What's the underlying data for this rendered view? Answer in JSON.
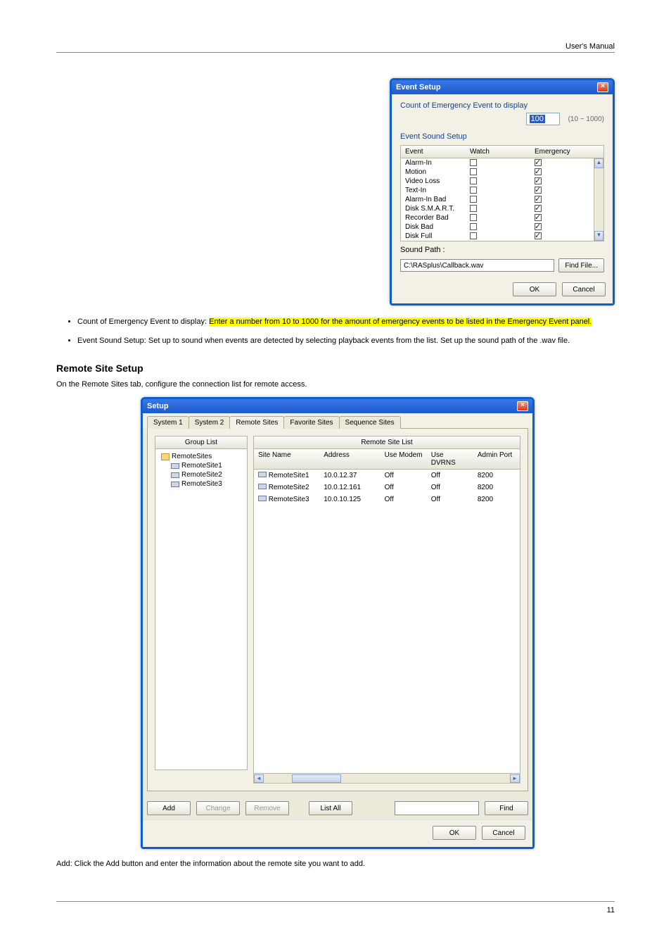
{
  "doc": {
    "header": "User's Manual",
    "page_number": "11",
    "bullets": [
      {
        "plain": "Count of Emergency Event to display: ",
        "hilite": "Enter a number from 10 to 1000 for the amount of emergency events to be listed in the Emergency Event panel."
      },
      {
        "plain": "Event Sound Setup: Set up to sound when events are detected by selecting playback events from the list. Set up the sound path of the .wav file."
      }
    ],
    "heading": "Remote Site Setup",
    "paragraph1": "On the Remote Sites tab, configure the connection list for remote access.",
    "paragraph2": "Add: Click the Add button and enter the information about the remote site you want to add."
  },
  "eventDialog": {
    "title": "Event Setup",
    "countLabel": "Count of Emergency Event to display",
    "countValue": "100",
    "countRange": "(10 ~ 1000)",
    "soundSetupLabel": "Event Sound Setup",
    "cols": {
      "event": "Event",
      "watch": "Watch",
      "emergency": "Emergency"
    },
    "rows": [
      {
        "name": "Alarm-In",
        "watch": false,
        "emergency": true
      },
      {
        "name": "Motion",
        "watch": false,
        "emergency": true
      },
      {
        "name": "Video Loss",
        "watch": false,
        "emergency": true
      },
      {
        "name": "Text-In",
        "watch": false,
        "emergency": true
      },
      {
        "name": "Alarm-In Bad",
        "watch": false,
        "emergency": true
      },
      {
        "name": "Disk S.M.A.R.T.",
        "watch": false,
        "emergency": true
      },
      {
        "name": "Recorder Bad",
        "watch": false,
        "emergency": true
      },
      {
        "name": "Disk Bad",
        "watch": false,
        "emergency": true
      },
      {
        "name": "Disk Full",
        "watch": false,
        "emergency": true
      }
    ],
    "soundPathLabel": "Sound Path :",
    "soundPathValue": "C:\\RASplus\\Callback.wav",
    "findFile": "Find File...",
    "ok": "OK",
    "cancel": "Cancel"
  },
  "setupDialog": {
    "title": "Setup",
    "tabs": [
      "System 1",
      "System 2",
      "Remote Sites",
      "Favorite Sites",
      "Sequence Sites"
    ],
    "activeTab": 2,
    "groupListLabel": "Group List",
    "tree": {
      "root": "RemoteSites",
      "children": [
        "RemoteSite1",
        "RemoteSite2",
        "RemoteSite3"
      ]
    },
    "siteListLabel": "Remote Site List",
    "cols": {
      "name": "Site Name",
      "addr": "Address",
      "modem": "Use Modem",
      "dvrns": "Use DVRNS",
      "port": "Admin Port"
    },
    "rows": [
      {
        "name": "RemoteSite1",
        "addr": "10.0.12.37",
        "modem": "Off",
        "dvrns": "Off",
        "port": "8200"
      },
      {
        "name": "RemoteSite2",
        "addr": "10.0.12.161",
        "modem": "Off",
        "dvrns": "Off",
        "port": "8200"
      },
      {
        "name": "RemoteSite3",
        "addr": "10.0.10.125",
        "modem": "Off",
        "dvrns": "Off",
        "port": "8200"
      }
    ],
    "buttons": {
      "add": "Add",
      "change": "Change",
      "remove": "Remove",
      "listAll": "List All",
      "find": "Find",
      "ok": "OK",
      "cancel": "Cancel"
    }
  }
}
